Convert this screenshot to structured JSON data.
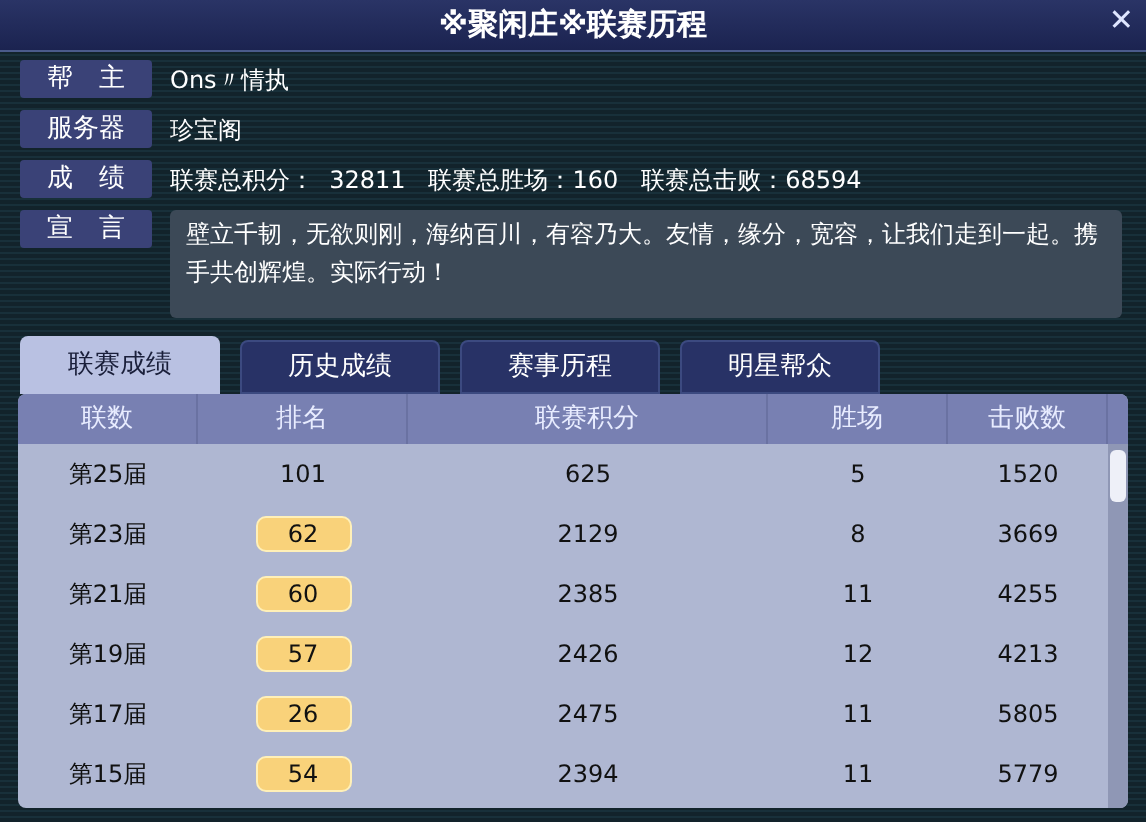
{
  "window": {
    "title": "※聚闲庄※联赛历程",
    "close": "✕"
  },
  "info": [
    {
      "label": "帮　主",
      "value": "Ons〃情执"
    },
    {
      "label": "服务器",
      "value": "珍宝阁"
    },
    {
      "label": "成　绩",
      "value": "联赛总积分：  32811   联赛总胜场：160   联赛总击败：68594"
    }
  ],
  "declaration": {
    "label": "宣　言",
    "value": "壁立千韧，无欲则刚，海纳百川，有容乃大。友情，缘分，宽容，让我们走到一起。携手共创辉煌。实际行动！"
  },
  "tabs": [
    {
      "label": "联赛成绩",
      "selected": true
    },
    {
      "label": "历史成绩",
      "selected": false
    },
    {
      "label": "赛事历程",
      "selected": false
    },
    {
      "label": "明星帮众",
      "selected": false
    }
  ],
  "table": {
    "columns": [
      "联数",
      "排名",
      "联赛积分",
      "胜场",
      "击败数"
    ],
    "rows": [
      {
        "season": "第25届",
        "rank": "101",
        "badge": false,
        "score": "625",
        "wins": "5",
        "kills": "1520"
      },
      {
        "season": "第23届",
        "rank": "62",
        "badge": true,
        "score": "2129",
        "wins": "8",
        "kills": "3669"
      },
      {
        "season": "第21届",
        "rank": "60",
        "badge": true,
        "score": "2385",
        "wins": "11",
        "kills": "4255"
      },
      {
        "season": "第19届",
        "rank": "57",
        "badge": true,
        "score": "2426",
        "wins": "12",
        "kills": "4213"
      },
      {
        "season": "第17届",
        "rank": "26",
        "badge": true,
        "score": "2475",
        "wins": "11",
        "kills": "5805"
      },
      {
        "season": "第15届",
        "rank": "54",
        "badge": true,
        "score": "2394",
        "wins": "11",
        "kills": "5779"
      }
    ]
  }
}
